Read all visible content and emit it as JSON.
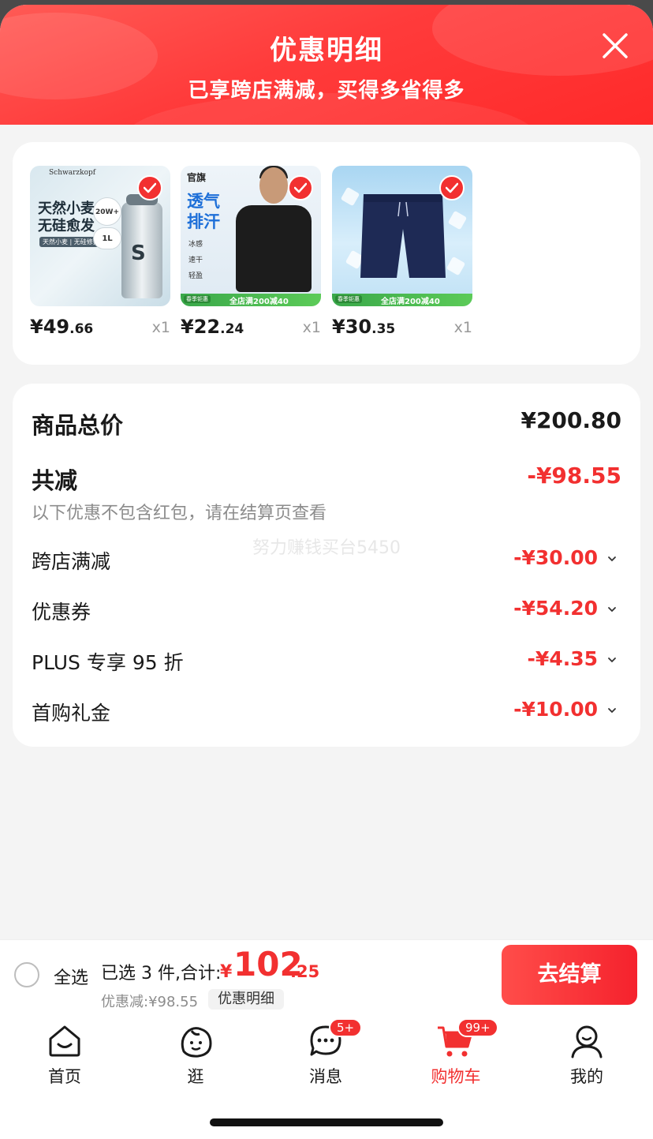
{
  "header": {
    "title": "优惠明细",
    "subtitle": "已享跨店满减，买得多省得多"
  },
  "products": [
    {
      "price_int": "¥49",
      "price_dec": ".66",
      "qty": "x1",
      "thumb_text": "天然小麦\n无硅愈发",
      "thumb_tag": "天然小麦 | 无硅修护",
      "badge1": "20W+",
      "badge2": "1L",
      "bottle_letter": "S",
      "brand": "Schwarzkopf"
    },
    {
      "price_int": "¥22",
      "price_dec": ".24",
      "qty": "x1",
      "thumb_brand": "官旗",
      "thumb_text": "透气\n排汗",
      "features": [
        "冰感",
        "速干",
        "轻盈"
      ],
      "promo_label": "春季钜惠",
      "promo_text": "全店满200减40"
    },
    {
      "price_int": "¥30",
      "price_dec": ".35",
      "qty": "x1",
      "promo_label": "春季钜惠",
      "promo_text": "全店满200减40"
    }
  ],
  "summary": {
    "total_label": "商品总价",
    "total_value": "¥200.80",
    "reduce_label": "共减",
    "reduce_value": "-¥98.55",
    "note": "以下优惠不包含红包，请在结算页查看",
    "watermark": "努力赚钱买台5450",
    "details": [
      {
        "label": "跨店满减",
        "value": "-¥30.00"
      },
      {
        "label": "优惠券",
        "value": "-¥54.20"
      },
      {
        "label": "PLUS 专享 95 折",
        "value": "-¥4.35"
      },
      {
        "label": "首购礼金",
        "value": "-¥10.00"
      }
    ]
  },
  "bottom_bar": {
    "select_all": "全选",
    "selected_count": "已选 3 件,合计:",
    "total_yen": "¥",
    "total_int": "102",
    "total_dec": ".25",
    "discount": "优惠减:¥98.55",
    "detail_chip": "优惠明细",
    "checkout": "去结算"
  },
  "tabbar": {
    "items": [
      {
        "label": "首页",
        "icon": "home-icon"
      },
      {
        "label": "逛",
        "icon": "explore-icon"
      },
      {
        "label": "消息",
        "icon": "message-icon",
        "badge": "5+"
      },
      {
        "label": "购物车",
        "icon": "cart-icon",
        "badge": "99+",
        "active": true
      },
      {
        "label": "我的",
        "icon": "profile-icon"
      }
    ]
  },
  "colors": {
    "accent": "#f23030",
    "header": "#ff3b3b",
    "background": "#f4f4f4"
  }
}
